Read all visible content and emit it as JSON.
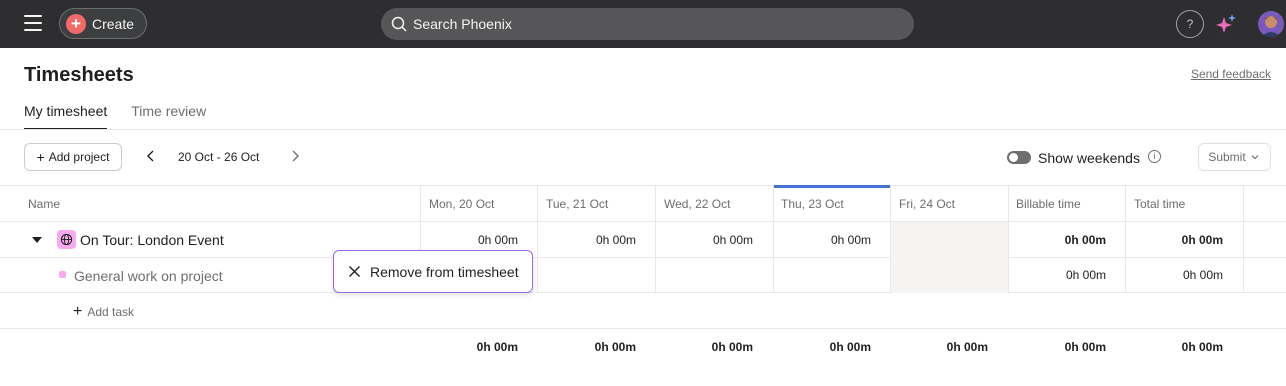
{
  "topbar": {
    "create_label": "Create",
    "search_placeholder": "Search Phoenix",
    "help_label": "?"
  },
  "header": {
    "title": "Timesheets",
    "feedback_link": "Send feedback",
    "tabs": [
      {
        "label": "My timesheet",
        "active": true
      },
      {
        "label": "Time review",
        "active": false
      }
    ]
  },
  "toolbar": {
    "add_project_label": "Add project",
    "date_range": "20 Oct - 26 Oct",
    "show_weekends_label": "Show weekends",
    "show_weekends_on": false,
    "submit_label": "Submit"
  },
  "table": {
    "columns": [
      "Name",
      "Mon, 20 Oct",
      "Tue, 21 Oct",
      "Wed, 22 Oct",
      "Thu, 23 Oct",
      "Fri, 24 Oct",
      "Billable time",
      "Total time"
    ],
    "today_column": "Thu, 23 Oct",
    "project": {
      "name": "On Tour: London Event",
      "values": [
        "0h 00m",
        "0h 00m",
        "0h 00m",
        "0h 00m",
        "",
        "0h 00m",
        "0h 00m"
      ]
    },
    "task": {
      "name": "General work on project",
      "billable": "0h 00m",
      "total": "0h 00m"
    },
    "add_task_label": "Add task",
    "totals": [
      "0h 00m",
      "0h 00m",
      "0h 00m",
      "0h 00m",
      "0h 00m",
      "0h 00m",
      "0h 00m"
    ]
  },
  "popover": {
    "label": "Remove from timesheet"
  },
  "colors": {
    "topbar": "#2e2e30",
    "create_accent": "#f06a6a",
    "today_accent": "#4573d2",
    "project_color": "#f9aaef",
    "popover_border": "#9b6bd9"
  }
}
